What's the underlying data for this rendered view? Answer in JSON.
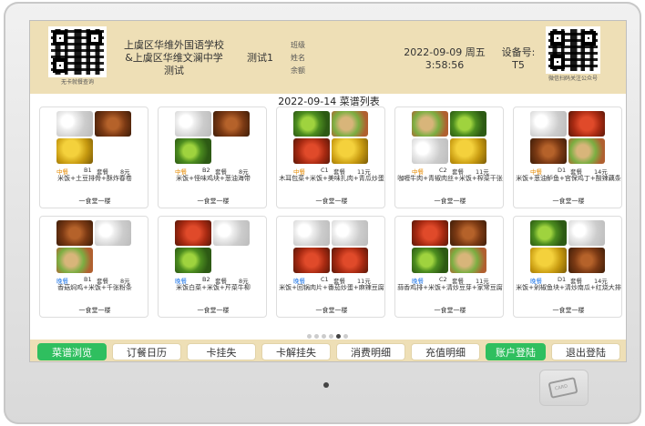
{
  "header": {
    "qr_left_caption": "无卡就餐查询",
    "school_line1": "上虞区华维外国语学校",
    "school_line2": "&上虞区华维文澜中学",
    "school_line3": "测试",
    "user_name": "测试1",
    "info_labels": [
      "班级",
      "姓名",
      "余额"
    ],
    "date_line": "2022-09-09 周五",
    "time_line": "3:58:56",
    "device_label": "设备号:",
    "device_value": "T5",
    "qr_right_caption": "微信扫码关注公众号"
  },
  "list_title": "2022-09-14 菜谱列表",
  "cards": [
    {
      "tag": "中餐",
      "code": "B1",
      "kind": "套餐",
      "price": "8元",
      "desc": "米饭+土豆排骨+酥炸春卷",
      "loc": "一食堂一楼",
      "imgs": [
        "rice",
        "meat",
        "yellow"
      ]
    },
    {
      "tag": "中餐",
      "code": "B2",
      "kind": "套餐",
      "price": "8元",
      "desc": "米饭+怪味鸡块+葱油海带",
      "loc": "一食堂一楼",
      "imgs": [
        "rice",
        "meat",
        "greens"
      ]
    },
    {
      "tag": "中餐",
      "code": "C1",
      "kind": "套餐",
      "price": "11元",
      "desc": "木耳包菜+米饭+美味扎肉+青瓜炒蛋",
      "loc": "一食堂一楼",
      "imgs": [
        "greens",
        "mix",
        "red",
        "yellow"
      ]
    },
    {
      "tag": "中餐",
      "code": "C2",
      "kind": "套餐",
      "price": "11元",
      "desc": "咖喱牛肉+青椒肉丝+米饭+榨菜干张",
      "loc": "一食堂一楼",
      "imgs": [
        "mix",
        "greens",
        "rice",
        "yellow"
      ]
    },
    {
      "tag": "中餐",
      "code": "D1",
      "kind": "套餐",
      "price": "14元",
      "desc": "米饭+葱油鲈鱼+宫保鸡丁+酸辣藕条",
      "loc": "一食堂一楼",
      "imgs": [
        "rice",
        "red",
        "meat",
        "mix"
      ]
    },
    {
      "tag": "晚餐",
      "code": "B1",
      "kind": "套餐",
      "price": "8元",
      "desc": "香菇焖鸡+米饭+千张粉条",
      "loc": "一食堂一楼",
      "imgs": [
        "meat",
        "rice",
        "mix"
      ]
    },
    {
      "tag": "晚餐",
      "code": "B2",
      "kind": "套餐",
      "price": "8元",
      "desc": "米饭白菜+米饭+芹菜牛柳",
      "loc": "一食堂一楼",
      "imgs": [
        "red",
        "rice",
        "greens"
      ]
    },
    {
      "tag": "晚餐",
      "code": "C1",
      "kind": "套餐",
      "price": "11元",
      "desc": "米饭+回锅肉片+番茄炒蛋+麻辣豆腐",
      "loc": "一食堂一楼",
      "imgs": [
        "rice",
        "rice",
        "red",
        "red"
      ]
    },
    {
      "tag": "晚餐",
      "code": "C2",
      "kind": "套餐",
      "price": "11元",
      "desc": "蒜香鸡排+米饭+清炒豆芽+家常豆腐",
      "loc": "一食堂一楼",
      "imgs": [
        "red",
        "meat",
        "greens",
        "mix"
      ]
    },
    {
      "tag": "晚餐",
      "code": "D1",
      "kind": "套餐",
      "price": "14元",
      "desc": "米饭+剁椒鱼块+清炒南瓜+红烧大排",
      "loc": "一食堂一楼",
      "imgs": [
        "greens",
        "rice",
        "yellow",
        "meat"
      ]
    }
  ],
  "pager": {
    "count": 6,
    "active": 4
  },
  "buttons": [
    {
      "label": "菜谱浏览",
      "active": true
    },
    {
      "label": "订餐日历",
      "active": false
    },
    {
      "label": "卡挂失",
      "active": false
    },
    {
      "label": "卡解挂失",
      "active": false
    },
    {
      "label": "消费明细",
      "active": false
    },
    {
      "label": "充值明细",
      "active": false
    },
    {
      "label": "账户登陆",
      "active": true
    },
    {
      "label": "退出登陆",
      "active": false
    }
  ],
  "reader_label": "CARD",
  "colors": {
    "header_bg": "#eedfb6",
    "active_button": "#2fbf5f",
    "lunch_tag": "#e68a00",
    "dinner_tag": "#1a73e8"
  }
}
